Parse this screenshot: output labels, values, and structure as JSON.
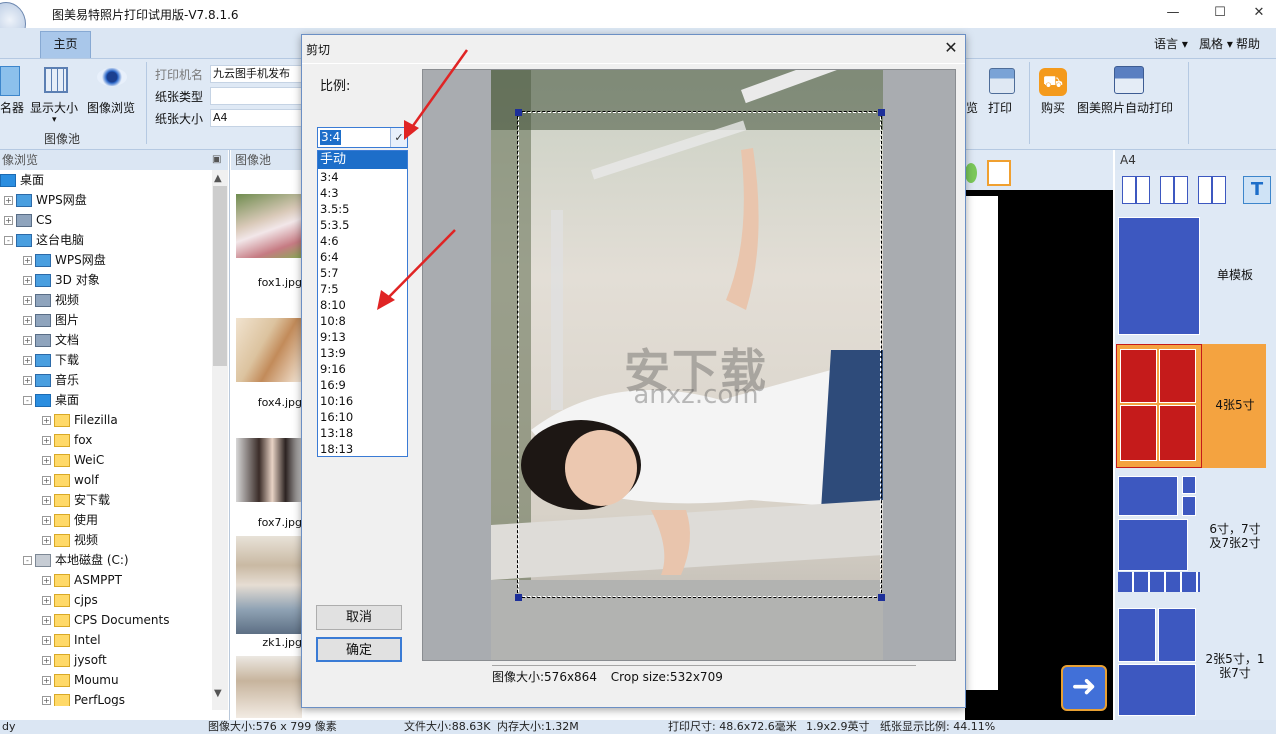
{
  "app": {
    "title": "图美易特照片打印试用版-V7.8.1.6",
    "window_min": "—",
    "window_max": "☐",
    "window_close": "✕"
  },
  "ribbon": {
    "tab_home": "主页",
    "menu_language": "语言",
    "menu_style": "風格",
    "menu_help": "帮助",
    "btn_namer": "名器",
    "btn_display_size": "显示大小",
    "btn_image_browse": "图像浏览",
    "group_image_pool": "图像池",
    "printer_label": "打印机名",
    "printer_value": "九云图手机发布",
    "paper_type_label": "纸张类型",
    "paper_type_value": "",
    "paper_size_label": "纸张大小",
    "paper_size_value": "A4",
    "btn_preview_partial": "览",
    "btn_print": "打印",
    "btn_buy": "购买",
    "btn_auto_print": "图美照片自动打印"
  },
  "left_panel": {
    "header": "像浏览",
    "pin": "ᵠ",
    "tree": [
      {
        "label": "桌面",
        "indent": 0,
        "icon": "desktop",
        "exp": ""
      },
      {
        "label": "WPS网盘",
        "indent": 1,
        "icon": "cloud",
        "exp": "+"
      },
      {
        "label": "CS",
        "indent": 1,
        "icon": "user",
        "exp": "+"
      },
      {
        "label": "这台电脑",
        "indent": 1,
        "icon": "pc",
        "exp": "-"
      },
      {
        "label": "WPS网盘",
        "indent": 2,
        "icon": "cloud",
        "exp": "+"
      },
      {
        "label": "3D 对象",
        "indent": 2,
        "icon": "cube",
        "exp": "+"
      },
      {
        "label": "视频",
        "indent": 2,
        "icon": "video",
        "exp": "+"
      },
      {
        "label": "图片",
        "indent": 2,
        "icon": "picture",
        "exp": "+"
      },
      {
        "label": "文档",
        "indent": 2,
        "icon": "doc",
        "exp": "+"
      },
      {
        "label": "下载",
        "indent": 2,
        "icon": "download",
        "exp": "+"
      },
      {
        "label": "音乐",
        "indent": 2,
        "icon": "music",
        "exp": "+"
      },
      {
        "label": "桌面",
        "indent": 2,
        "icon": "desktop",
        "exp": "-"
      },
      {
        "label": "Filezilla",
        "indent": 3,
        "icon": "folder",
        "exp": "+"
      },
      {
        "label": "fox",
        "indent": 3,
        "icon": "folder",
        "exp": "+"
      },
      {
        "label": "WeiC",
        "indent": 3,
        "icon": "folder",
        "exp": "+"
      },
      {
        "label": "wolf",
        "indent": 3,
        "icon": "folder",
        "exp": "+"
      },
      {
        "label": "安下载",
        "indent": 3,
        "icon": "folder",
        "exp": "+"
      },
      {
        "label": "使用",
        "indent": 3,
        "icon": "folder",
        "exp": "+"
      },
      {
        "label": "视频",
        "indent": 3,
        "icon": "folder",
        "exp": "+"
      },
      {
        "label": "本地磁盘 (C:)",
        "indent": 2,
        "icon": "disk",
        "exp": "-"
      },
      {
        "label": "ASMPPT",
        "indent": 3,
        "icon": "folder",
        "exp": "+"
      },
      {
        "label": "cjps",
        "indent": 3,
        "icon": "folder",
        "exp": "+"
      },
      {
        "label": "CPS Documents",
        "indent": 3,
        "icon": "folder",
        "exp": "+"
      },
      {
        "label": "Intel",
        "indent": 3,
        "icon": "folder",
        "exp": "+"
      },
      {
        "label": "jysoft",
        "indent": 3,
        "icon": "folder",
        "exp": "+"
      },
      {
        "label": "Moumu",
        "indent": 3,
        "icon": "folder",
        "exp": "+"
      },
      {
        "label": "PerfLogs",
        "indent": 3,
        "icon": "folder",
        "exp": "+"
      }
    ]
  },
  "mid_panel": {
    "header": "图像池",
    "thumbs": [
      {
        "file": "fox1.jpg"
      },
      {
        "file": "fox4.jpg"
      },
      {
        "file": "fox7.jpg"
      },
      {
        "file": "zk1.jpg"
      }
    ]
  },
  "right_panel": {
    "header": "A4",
    "templates": [
      {
        "label": "单模板"
      },
      {
        "label": "4张5寸"
      },
      {
        "label": "6寸，7寸及7张2寸"
      },
      {
        "label": "2张5寸，1张7寸"
      }
    ]
  },
  "dialog": {
    "title": "剪切",
    "close": "✕",
    "ratio_label": "比例:",
    "selected_ratio": "3:4",
    "options": [
      "手动",
      "3:4",
      "4:3",
      "3.5:5",
      "5:3.5",
      "4:6",
      "6:4",
      "5:7",
      "7:5",
      "8:10",
      "10:8",
      "9:13",
      "13:9",
      "9:16",
      "16:9",
      "10:16",
      "16:10",
      "13:18",
      "18:13"
    ],
    "highlighted_option": "手动",
    "btn_cancel": "取消",
    "btn_ok": "确定",
    "image_size": "图像大小:576x864",
    "crop_size": "Crop size:532x709",
    "watermark_main": "安下载",
    "watermark_sub": "anxz.com"
  },
  "status": {
    "left": "dy",
    "image_size": "图像大小:576 x 799 像素",
    "file_size": "文件大小:88.63K",
    "mem_size": "内存大小:1.32M",
    "print_size": "打印尺寸: 48.6x72.6毫米",
    "inch_size": "1.9x2.9英寸",
    "paper_ratio": "纸张显示比例: 44.11%"
  },
  "colors": {
    "accent": "#3a7bd5",
    "arrow": "#e02424",
    "template_blue": "#3d58c0",
    "template_red": "#c51b1b",
    "template_selected_bg": "#f4a340"
  },
  "icons": {
    "next": "arrow-right-icon",
    "dropdown": "chevron-down-icon"
  }
}
